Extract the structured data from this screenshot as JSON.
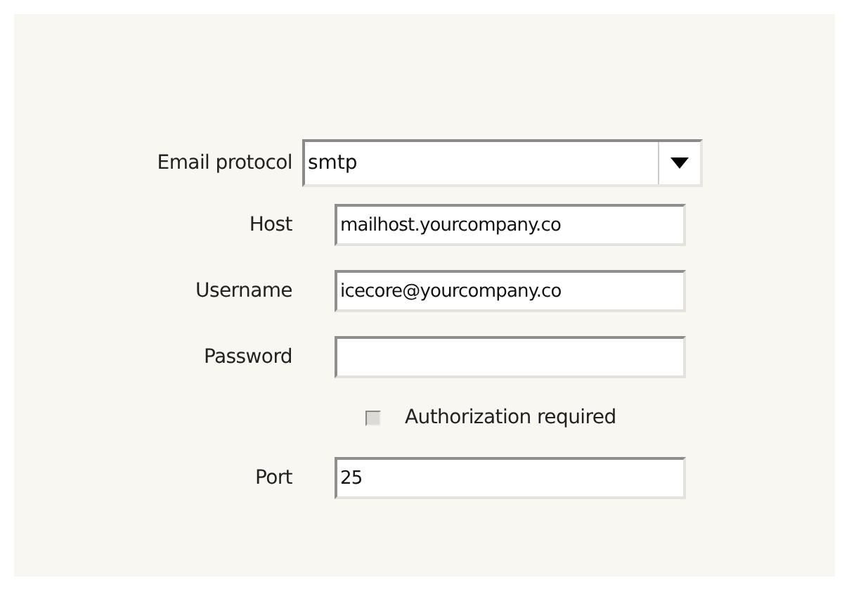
{
  "fields": [
    {
      "kind": "select",
      "label": "Email protocol",
      "value": "smtp"
    },
    {
      "kind": "text",
      "label": "Host",
      "value": "mailhost.yourcompany.co"
    },
    {
      "kind": "text",
      "label": "Username",
      "value": "icecore@yourcompany.co"
    },
    {
      "kind": "text",
      "label": "Password"
    },
    {
      "kind": "checkbox",
      "label": "Authorization required",
      "checked": false
    },
    {
      "kind": "text",
      "label": "Port",
      "value": "25"
    }
  ]
}
